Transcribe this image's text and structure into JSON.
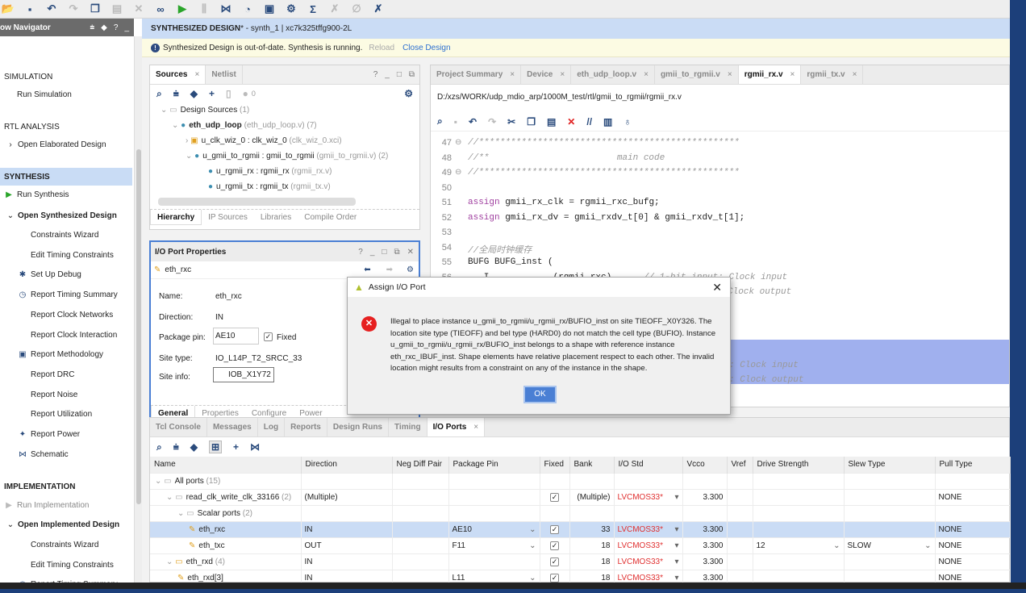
{
  "toolbar": {
    "icons": [
      "open-project-icon",
      "save-icon",
      "undo-icon",
      "redo-icon",
      "copy-icon",
      "paste-icon",
      "delete-icon",
      "find-icon",
      "run-icon",
      "step-icon",
      "schematic-icon",
      "timing-icon",
      "report-icon",
      "settings-icon",
      "sum-icon",
      "debug-icon",
      "pen-icon",
      "cancel-icon"
    ]
  },
  "nav": {
    "title": "ow Navigator",
    "items": [
      {
        "label": "SIMULATION",
        "type": "section"
      },
      {
        "label": "Run Simulation",
        "type": "item"
      },
      {
        "label": "RTL ANALYSIS",
        "type": "section"
      },
      {
        "label": "Open Elaborated Design",
        "type": "expand"
      },
      {
        "label": "SYNTHESIS",
        "type": "section-selected"
      },
      {
        "label": "Run Synthesis",
        "type": "run"
      },
      {
        "label": "Open Synthesized Design",
        "type": "expanded"
      },
      {
        "label": "Constraints Wizard",
        "type": "sub"
      },
      {
        "label": "Edit Timing Constraints",
        "type": "sub"
      },
      {
        "label": "Set Up Debug",
        "type": "sub-icon",
        "icon": "bug-icon"
      },
      {
        "label": "Report Timing Summary",
        "type": "sub-icon",
        "icon": "stopwatch-icon"
      },
      {
        "label": "Report Clock Networks",
        "type": "sub"
      },
      {
        "label": "Report Clock Interaction",
        "type": "sub"
      },
      {
        "label": "Report Methodology",
        "type": "sub-icon",
        "icon": "clipboard-icon"
      },
      {
        "label": "Report DRC",
        "type": "sub"
      },
      {
        "label": "Report Noise",
        "type": "sub"
      },
      {
        "label": "Report Utilization",
        "type": "sub"
      },
      {
        "label": "Report Power",
        "type": "sub-icon",
        "icon": "power-icon"
      },
      {
        "label": "Schematic",
        "type": "sub-icon",
        "icon": "schematic-icon"
      },
      {
        "label": "IMPLEMENTATION",
        "type": "section"
      },
      {
        "label": "Run Implementation",
        "type": "run-disabled"
      },
      {
        "label": "Open Implemented Design",
        "type": "expanded"
      },
      {
        "label": "Constraints Wizard",
        "type": "sub"
      },
      {
        "label": "Edit Timing Constraints",
        "type": "sub"
      },
      {
        "label": "Report Timing Summary",
        "type": "sub-icon",
        "icon": "stopwatch-icon"
      }
    ]
  },
  "design": {
    "title": "SYNTHESIZED DESIGN",
    "rest": " * - synth_1 | xc7k325tffg900-2L",
    "warning": "Synthesized Design is out-of-date. Synthesis is running.",
    "reload": "Reload",
    "close": "Close Design"
  },
  "sources": {
    "tabs": [
      "Sources",
      "Netlist"
    ],
    "count": "0",
    "tree": [
      {
        "name": "Design Sources",
        "extra": "(1)"
      },
      {
        "name": "eth_udp_loop",
        "extra": "(eth_udp_loop.v) (7)"
      },
      {
        "name": "u_clk_wiz_0 : clk_wiz_0",
        "extra": "(clk_wiz_0.xci)"
      },
      {
        "name": "u_gmii_to_rgmii : gmii_to_rgmii",
        "extra": "(gmii_to_rgmii.v) (2)"
      },
      {
        "name": "u_rgmii_rx : rgmii_rx",
        "extra": "(rgmii_rx.v)"
      },
      {
        "name": "u_rgmii_tx : rgmii_tx",
        "extra": "(rgmii_tx.v)"
      }
    ],
    "bottom_tabs": [
      "Hierarchy",
      "IP Sources",
      "Libraries",
      "Compile Order"
    ]
  },
  "props": {
    "title": "I/O Port Properties",
    "port": "eth_rxc",
    "name_label": "Name:",
    "name": "eth_rxc",
    "dir_label": "Direction:",
    "dir": "IN",
    "pin_label": "Package pin:",
    "pin": "AE10",
    "fixed": "Fixed",
    "site_type_label": "Site type:",
    "site_type": "IO_L14P_T2_SRCC_33",
    "site_info_label": "Site info:",
    "site_info": "IOB_X1Y72",
    "tabs": [
      "General",
      "Properties",
      "Configure",
      "Power"
    ]
  },
  "editor": {
    "tabs": [
      "Project Summary",
      "Device",
      "eth_udp_loop.v",
      "gmii_to_rgmii.v",
      "rgmii_rx.v",
      "rgmii_tx.v"
    ],
    "active": 4,
    "path": "D:/xzs/WORK/udp_mdio_arp/1000M_test/rtl/gmii_to_rgmii/rgmii_rx.v",
    "lines": [
      {
        "n": "47",
        "t": "//*************************************************",
        "c": "cm"
      },
      {
        "n": "48",
        "t": "//**                        main code",
        "c": "cm"
      },
      {
        "n": "49",
        "t": "//*************************************************",
        "c": "cm"
      },
      {
        "n": "50",
        "t": "",
        "c": ""
      },
      {
        "n": "51",
        "kw": "assign",
        "t": " gmii_rx_clk = rgmii_rxc_bufg;",
        "c": ""
      },
      {
        "n": "52",
        "kw": "assign",
        "t": " gmii_rx_dv = gmii_rxdv_t[0] & gmii_rxdv_t[1];",
        "c": ""
      },
      {
        "n": "53",
        "t": "",
        "c": ""
      },
      {
        "n": "54",
        "t": "//全局时钟缓存",
        "c": "cm"
      },
      {
        "n": "55",
        "t": "BUFG BUFG_inst (",
        "c": ""
      },
      {
        "n": "56",
        "t": "  .I            (rgmii_rxc),     ",
        "cm": "// 1-bit input: Clock input"
      }
    ],
    "hidden_fragments": [
      "Clock output",
      ": Clock input",
      ": Clock output"
    ]
  },
  "dialog": {
    "title": "Assign I/O Port",
    "message": "Illegal to place instance u_gmii_to_rgmii/u_rgmii_rx/BUFIO_inst on site TIEOFF_X0Y326. The location site type (TIEOFF) and bel type (HARD0) do not match the cell type (BUFIO). Instance u_gmii_to_rgmii/u_rgmii_rx/BUFIO_inst belongs to a shape with reference instance eth_rxc_IBUF_inst. Shape elements have relative placement respect to each other. The invalid location might results from a constraint on any of the instance in the shape.",
    "ok": "OK"
  },
  "bottom": {
    "tabs": [
      "Tcl Console",
      "Messages",
      "Log",
      "Reports",
      "Design Runs",
      "Timing",
      "I/O Ports"
    ],
    "active": 6,
    "columns": [
      "Name",
      "Direction",
      "Neg Diff Pair",
      "Package Pin",
      "Fixed",
      "Bank",
      "I/O Std",
      "Vcco",
      "Vref",
      "Drive Strength",
      "Slew Type",
      "Pull Type"
    ],
    "rows": [
      {
        "name": "All ports",
        "count": "(15)",
        "level": 0,
        "dir": "",
        "pin": "",
        "fixed": false,
        "bank": "",
        "std": "",
        "vcco": "",
        "drive": "",
        "slew": "",
        "pull": ""
      },
      {
        "name": "read_clk_write_clk_33166",
        "count": "(2)",
        "level": 1,
        "dir": "(Multiple)",
        "pin": "",
        "fixed": true,
        "bank": "(Multiple)",
        "std": "LVCMOS33*",
        "vcco": "3.300",
        "drive": "",
        "slew": "",
        "pull": "NONE"
      },
      {
        "name": "Scalar ports",
        "count": "(2)",
        "level": 2,
        "dir": "",
        "pin": "",
        "fixed": false,
        "bank": "",
        "std": "",
        "vcco": "",
        "drive": "",
        "slew": "",
        "pull": ""
      },
      {
        "name": "eth_rxc",
        "count": "",
        "level": 3,
        "dir": "IN",
        "pin": "AE10",
        "fixed": true,
        "bank": "33",
        "std": "LVCMOS33*",
        "vcco": "3.300",
        "drive": "",
        "slew": "",
        "pull": "NONE",
        "selected": true
      },
      {
        "name": "eth_txc",
        "count": "",
        "level": 3,
        "dir": "OUT",
        "pin": "F11",
        "fixed": true,
        "bank": "18",
        "std": "LVCMOS33*",
        "vcco": "3.300",
        "drive": "12",
        "slew": "SLOW",
        "pull": "NONE"
      },
      {
        "name": "eth_rxd",
        "count": "(4)",
        "level": 1,
        "dir": "IN",
        "pin": "",
        "fixed": true,
        "bank": "18",
        "std": "LVCMOS33*",
        "vcco": "3.300",
        "drive": "",
        "slew": "",
        "pull": "NONE"
      },
      {
        "name": "eth_rxd[3]",
        "count": "",
        "level": 2,
        "dir": "IN",
        "pin": "L11",
        "fixed": true,
        "bank": "18",
        "std": "LVCMOS33*",
        "vcco": "3.300",
        "drive": "",
        "slew": "",
        "pull": "NONE"
      }
    ]
  },
  "colors": {
    "accent": "#cadcf5",
    "warning_bg": "#fcfbe3",
    "error": "#e62020",
    "std_red": "#e03030",
    "highlight": "#a0b0ee",
    "ok_button": "#4a7fd4"
  }
}
